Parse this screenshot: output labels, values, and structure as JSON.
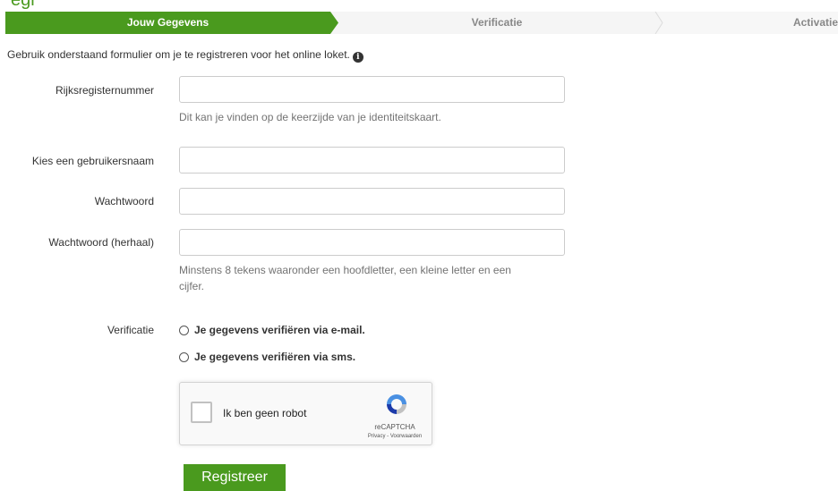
{
  "page": {
    "header_partial": "egi"
  },
  "steps": [
    {
      "label": "Jouw Gegevens",
      "active": true
    },
    {
      "label": "Verificatie",
      "active": false
    },
    {
      "label": "Activatie",
      "active": false
    }
  ],
  "intro": {
    "text": "Gebruik onderstaand formulier om je te registreren voor het online loket.",
    "icon": "info-icon"
  },
  "form": {
    "rijksregisternummer": {
      "label": "Rijksregisternummer",
      "value": "",
      "help": "Dit kan je vinden op de keerzijde van je identiteitskaart."
    },
    "gebruikersnaam": {
      "label": "Kies een gebruikersnaam",
      "value": ""
    },
    "wachtwoord": {
      "label": "Wachtwoord",
      "value": ""
    },
    "wachtwoord_herhaal": {
      "label": "Wachtwoord (herhaal)",
      "value": "",
      "help_line1": "Minstens 8 tekens waaronder een hoofdletter, een kleine letter en een",
      "help_line2": "cijfer."
    },
    "verificatie": {
      "label": "Verificatie",
      "options": [
        "Je gegevens verifiëren via e-mail.",
        "Je gegevens verifiëren via sms."
      ]
    }
  },
  "captcha": {
    "label": "Ik ben geen robot",
    "brand": "reCAPTCHA",
    "links": "Privacy - Voorwaarden"
  },
  "submit": {
    "label": "Registreer"
  },
  "colors": {
    "accent": "#4a9a1e",
    "step_inactive_bg": "#f3f3f3"
  }
}
